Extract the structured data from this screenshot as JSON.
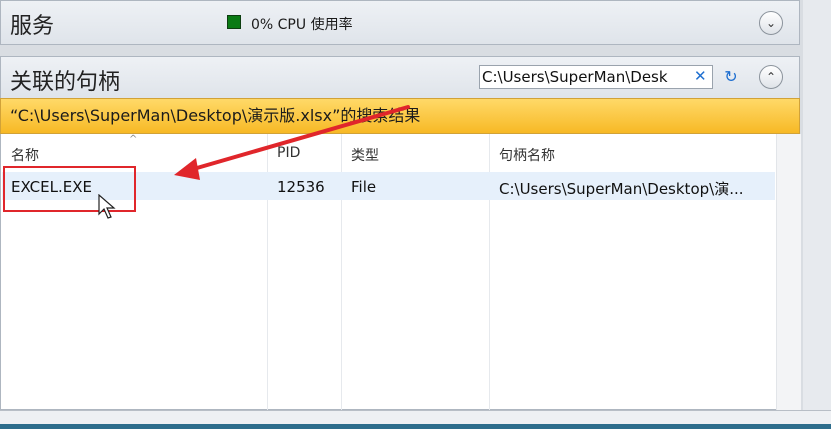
{
  "services": {
    "title": "服务",
    "cpu_text": "0% CPU 使用率",
    "toggle_glyph": "⌄"
  },
  "handles": {
    "title": "关联的句柄",
    "search_value": "C:\\Users\\SuperMan\\Desk",
    "clear_glyph": "✕",
    "refresh_glyph": "↻",
    "collapse_glyph": "⌃"
  },
  "result_banner": "“C:\\Users\\SuperMan\\Desktop\\演示版.xlsx”的搜索结果",
  "table": {
    "columns": [
      "名称",
      "PID",
      "类型",
      "句柄名称"
    ],
    "rows": [
      [
        "EXCEL.EXE",
        "12536",
        "File",
        "C:\\Users\\SuperMan\\Desktop\\演..."
      ]
    ]
  },
  "colors": {
    "banner": "#f7b925",
    "selected_row": "#e6f0fb",
    "highlight": "#e0262b",
    "cpu_indicator": "#0a7a14",
    "accent": "#1f6fd0"
  }
}
